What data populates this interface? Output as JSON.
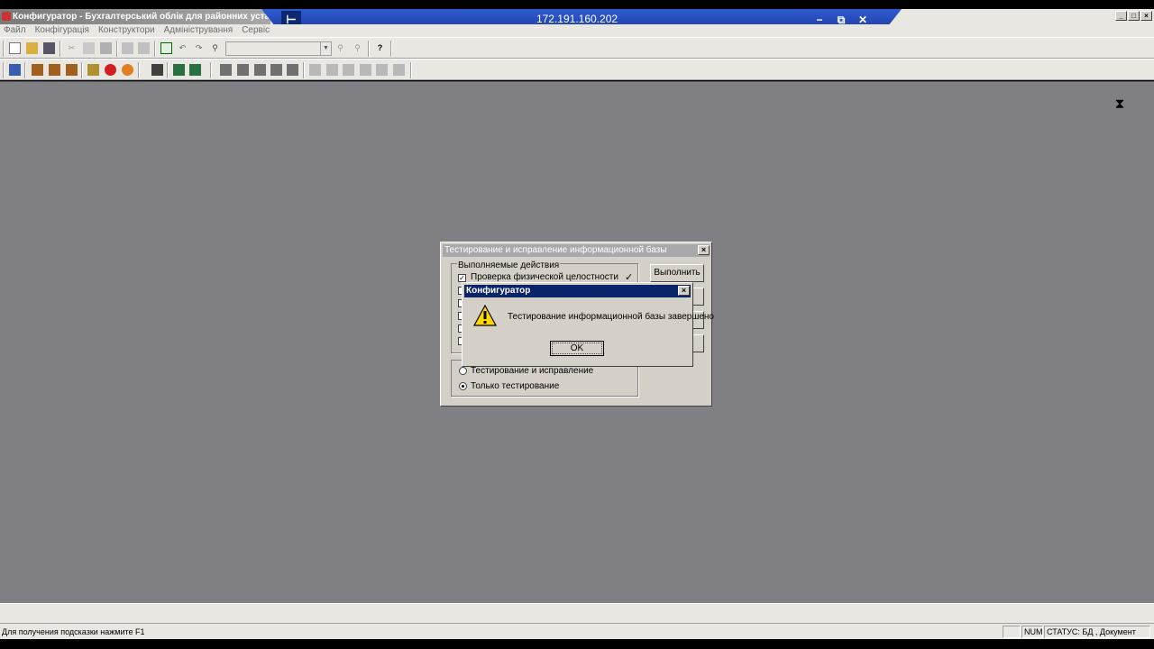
{
  "window": {
    "title": "Конфигуратор - Бухгалтерський облік для  районних уста",
    "min": "_",
    "max": "□",
    "close": "×"
  },
  "rdp": {
    "host": "172.191.160.202",
    "pin": "⊢",
    "min": "−",
    "restore": "⧉",
    "close": "✕"
  },
  "menu": [
    "Файл",
    "Конфігурація",
    "Конструктори",
    "Адміністрування",
    "Сервіс"
  ],
  "status": {
    "hint": "Для получения подсказки нажмите F1",
    "num": "NUM",
    "state": "СТАТУС: БД , Документ"
  },
  "test_dialog": {
    "title": "Тестирование и исправление информационной базы",
    "close": "×",
    "group_label": "Выполняемые действия",
    "action_1": "Проверка физической целостности",
    "action_1_done": "✓",
    "run_button": "Выполнить",
    "mode_1": "Тестирование и исправление",
    "mode_2": "Только тестирование"
  },
  "message_dialog": {
    "title": "Конфигуратор",
    "close": "×",
    "text": "Тестирование информационной базы завершено",
    "ok": "OK"
  }
}
